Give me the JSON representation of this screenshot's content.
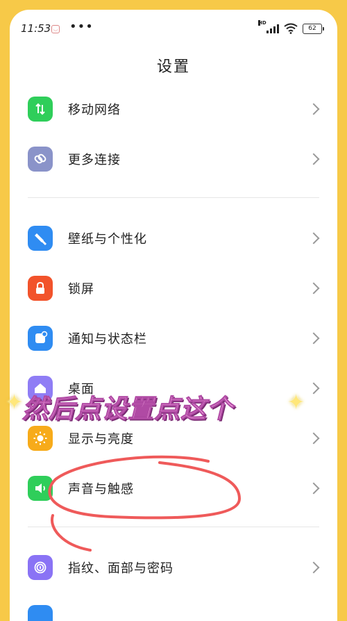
{
  "status_bar": {
    "time": "11:53",
    "network_label": "HD",
    "battery": "62"
  },
  "header": {
    "title": "设置"
  },
  "settings": {
    "items": [
      {
        "label": "移动网络",
        "icon": "mobile-data-icon",
        "color": "#2fce5a"
      },
      {
        "label": "更多连接",
        "icon": "link-icon",
        "color": "#8a93c9"
      },
      {
        "label": "壁纸与个性化",
        "icon": "brush-icon",
        "color": "#2f8cf2"
      },
      {
        "label": "锁屏",
        "icon": "lock-icon",
        "color": "#f2532b"
      },
      {
        "label": "通知与状态栏",
        "icon": "notification-icon",
        "color": "#2f8cf2"
      },
      {
        "label": "桌面",
        "icon": "home-icon",
        "color": "#8f7df5"
      },
      {
        "label": "显示与亮度",
        "icon": "sun-icon",
        "color": "#f7ab1a"
      },
      {
        "label": "声音与触感",
        "icon": "speaker-icon",
        "color": "#2fce5a"
      },
      {
        "label": "指纹、面部与密码",
        "icon": "fingerprint-icon",
        "color": "#8a73f5"
      }
    ]
  },
  "annotation": {
    "text": "然后点设置点这个"
  }
}
